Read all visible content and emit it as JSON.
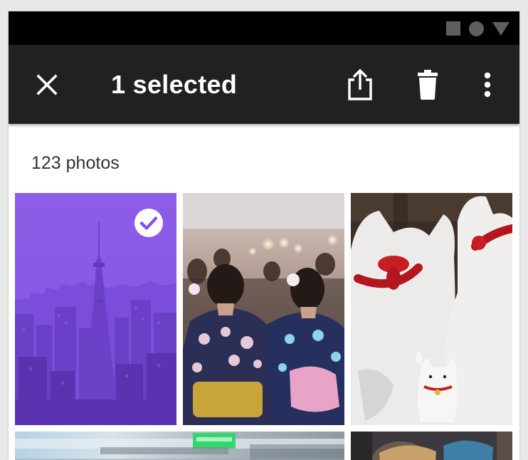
{
  "appbar": {
    "title": "1 selected",
    "close_icon": "close-icon",
    "actions": [
      "share-icon",
      "delete-icon",
      "more-vert-icon"
    ]
  },
  "status_bar": {
    "icons": [
      "square-icon",
      "circle-icon",
      "triangle-icon"
    ]
  },
  "gallery": {
    "count_label": "123 photos",
    "photos": [
      {
        "subject": "city skyline with tower",
        "selected": true
      },
      {
        "subject": "two people in kimonos at festival",
        "selected": false
      },
      {
        "subject": "white lucky cat figurines",
        "selected": false
      },
      {
        "subject": "blurred street scene",
        "selected": false
      },
      {
        "subject": "people at market",
        "selected": false
      }
    ]
  },
  "colors": {
    "appbar_bg": "#212121",
    "statusbar_bg": "#000000",
    "selection_tint": "#7c4dff",
    "text_primary": "#ffffff"
  }
}
